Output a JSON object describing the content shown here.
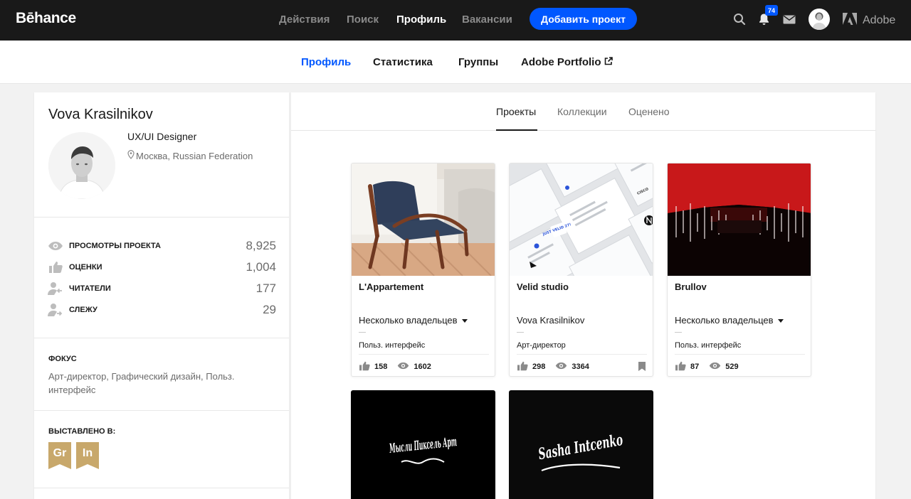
{
  "header": {
    "logo": "Bēhance",
    "nav": [
      {
        "label": "Действия",
        "active": false
      },
      {
        "label": "Поиск",
        "active": false
      },
      {
        "label": "Профиль",
        "active": true
      },
      {
        "label": "Вакансии",
        "active": false
      }
    ],
    "add_project": "Добавить проект",
    "icons": [
      "search-icon",
      "bell-icon",
      "mail-icon"
    ],
    "notification_count": "74",
    "adobe_label": "Adobe"
  },
  "subnav": {
    "items": [
      {
        "label": "Профиль",
        "active": true
      },
      {
        "label": "Статистика",
        "active": false
      },
      {
        "label": "Группы",
        "active": false
      },
      {
        "label": "Adobe Portfolio",
        "active": false,
        "external": true
      }
    ]
  },
  "profile": {
    "name": "Vova Krasilnikov",
    "role": "UX/UI Designer",
    "location": "Москва, Russian Federation",
    "stats": [
      {
        "icon": "eye-icon",
        "label": "ПРОСМОТРЫ ПРОЕКТА",
        "value": "8,925"
      },
      {
        "icon": "thumbs-up-icon",
        "label": "ОЦЕНКИ",
        "value": "1,004"
      },
      {
        "icon": "followers-icon",
        "label": "ЧИТАТЕЛИ",
        "value": "177"
      },
      {
        "icon": "following-icon",
        "label": "СЛЕЖУ",
        "value": "29"
      }
    ],
    "focus_heading": "ФОКУС",
    "focus_text": "Арт-директор, Графический дизайн, Польз. интерфейс",
    "featured_heading": "ВЫСТАВЛЕНО В:",
    "featured_badges": [
      "Gr",
      "In"
    ],
    "badge_color": "#c8a86b"
  },
  "main": {
    "tabs": [
      {
        "label": "Проекты",
        "active": true
      },
      {
        "label": "Коллекции",
        "active": false
      },
      {
        "label": "Оценено",
        "active": false
      }
    ],
    "projects": [
      {
        "title": "L'Appartement",
        "owner": "Несколько владельцев",
        "multi_owner": true,
        "field": "Польз. интерфейс",
        "likes": "158",
        "views": "1602",
        "bookmark": false
      },
      {
        "title": "Velid studio",
        "owner": "Vova Krasilnikov",
        "multi_owner": false,
        "field": "Арт-директор",
        "likes": "298",
        "views": "3364",
        "bookmark": true
      },
      {
        "title": "Brullov",
        "owner": "Несколько владельцев",
        "multi_owner": true,
        "field": "Польз. интерфейс",
        "likes": "87",
        "views": "529",
        "bookmark": false
      },
      {
        "title": "",
        "owner": "",
        "field": "",
        "likes": "",
        "views": ""
      },
      {
        "title": "",
        "owner": "",
        "field": "",
        "likes": "",
        "views": ""
      }
    ],
    "thumb_texts": {
      "velid_badge": "JUST VELID 27!",
      "velid_logo": "CISCO",
      "lettering_1": "Мысли Пиксель Арт",
      "lettering_2": "Sasha Intcenko"
    }
  },
  "colors": {
    "accent": "#0057ff",
    "topbar": "#191919",
    "brullov_red": "#c8181a"
  }
}
